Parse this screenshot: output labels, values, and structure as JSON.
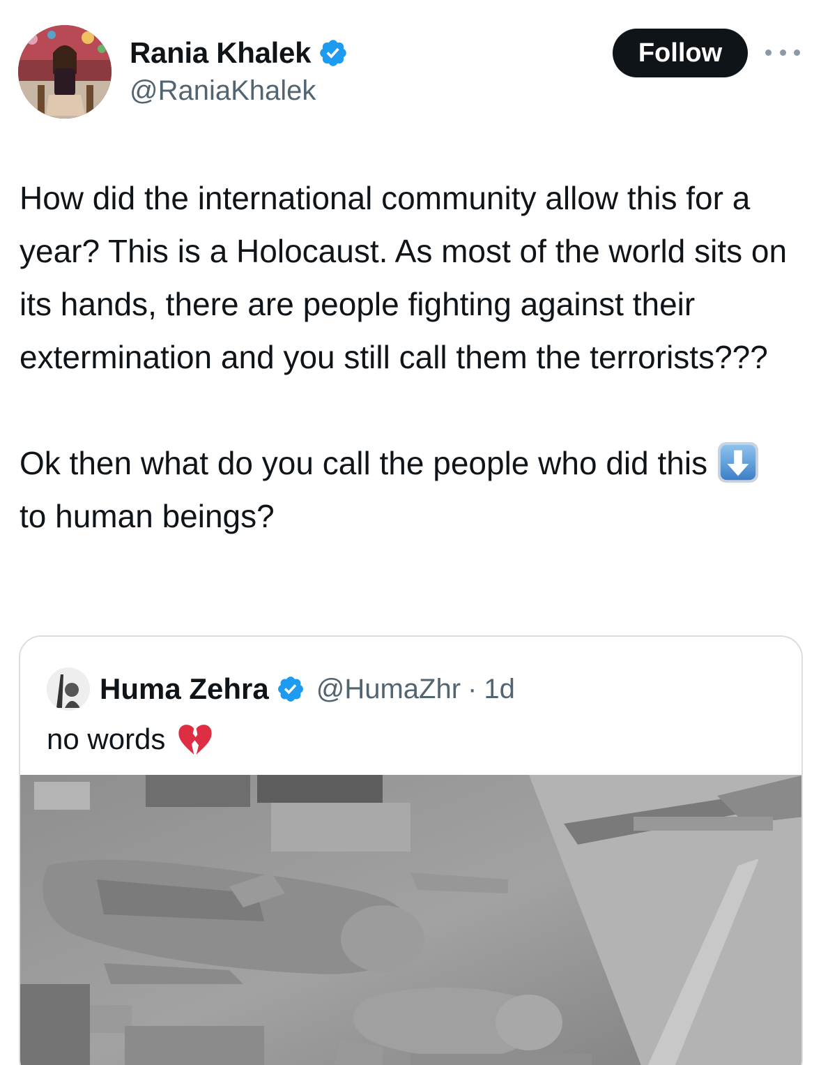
{
  "author": {
    "display_name": "Rania Khalek",
    "handle": "@RaniaKhalek",
    "verified": true
  },
  "actions": {
    "follow_label": "Follow",
    "more_icon": "ellipsis-icon"
  },
  "tweet": {
    "paragraph_1": "How did the international community allow this for a year? This is a Holocaust. As most of the world sits on its hands, there are people fighting against their extermination and you still call them the terrorists???",
    "paragraph_2_text": "Ok then what do you call the people who did this",
    "paragraph_2_tail": "to human beings?",
    "emoji": "down-arrow-emoji"
  },
  "quoted_tweet": {
    "display_name": "Huma Zehra",
    "handle": "@HumaZhr",
    "separator": "·",
    "time": "1d",
    "verified": true,
    "text": "no words",
    "emoji": "broken-heart-emoji",
    "image": "grey-rubble-photo"
  },
  "colors": {
    "text": "#0f1419",
    "secondary_text": "#536471",
    "verified_blue": "#1d9bf0",
    "follow_bg": "#0f1419",
    "border": "#d9dee2"
  }
}
